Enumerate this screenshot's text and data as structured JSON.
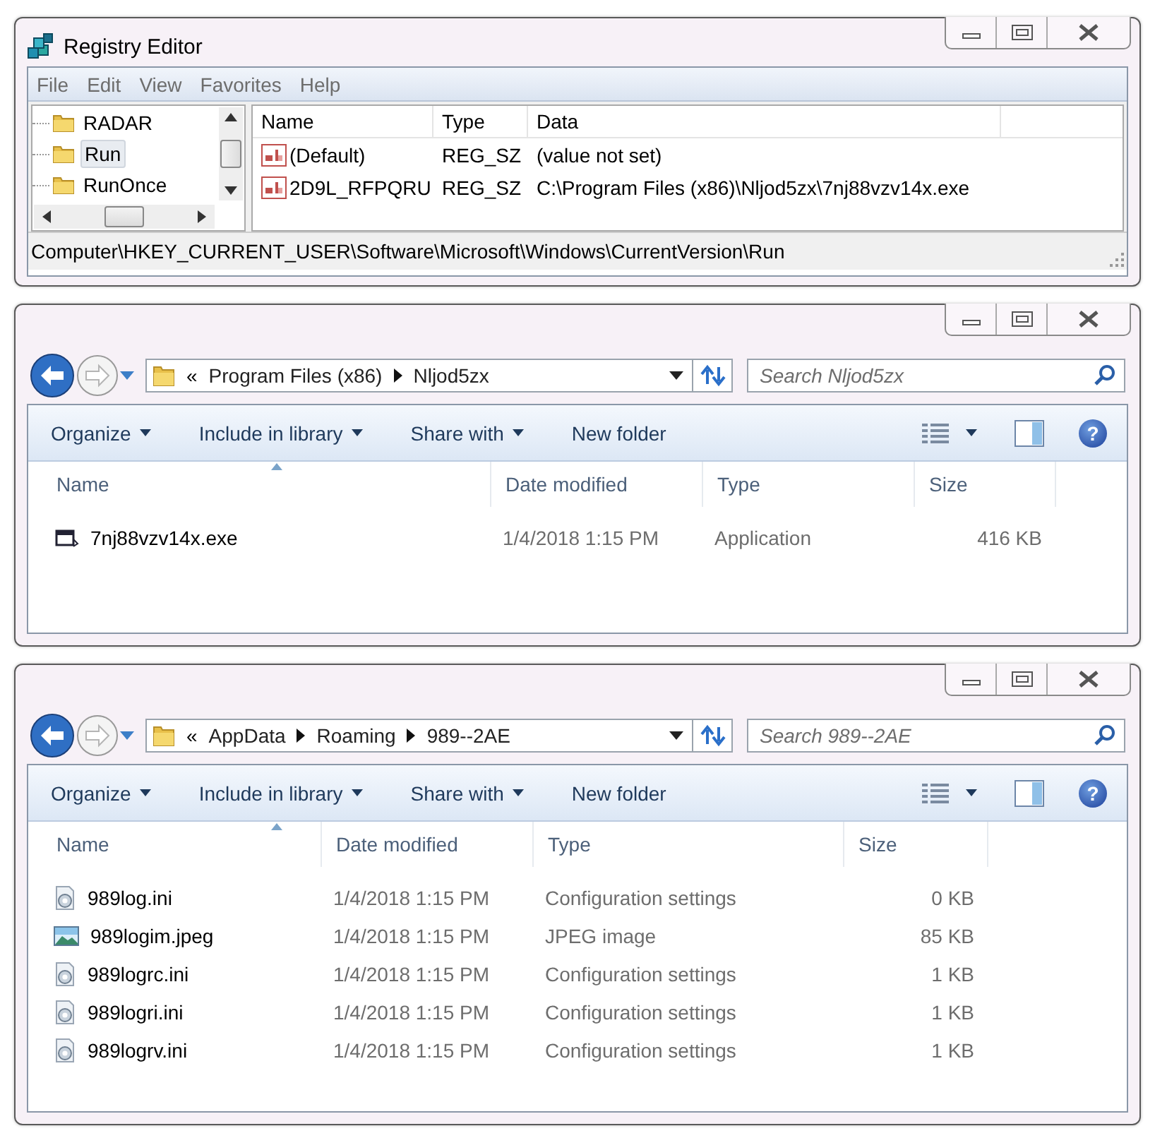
{
  "registry_editor": {
    "title": "Registry Editor",
    "menu": [
      "File",
      "Edit",
      "View",
      "Favorites",
      "Help"
    ],
    "tree": [
      {
        "label": "RADAR",
        "selected": false
      },
      {
        "label": "Run",
        "selected": true
      },
      {
        "label": "RunOnce",
        "selected": false
      }
    ],
    "columns": [
      "Name",
      "Type",
      "Data"
    ],
    "values": [
      {
        "name": "(Default)",
        "type": "REG_SZ",
        "data": "(value not set)"
      },
      {
        "name": "2D9L_RFPQRU",
        "type": "REG_SZ",
        "data": "C:\\Program Files (x86)\\Nljod5zx\\7nj88vzv14x.exe"
      }
    ],
    "status_bar": "Computer\\HKEY_CURRENT_USER\\Software\\Microsoft\\Windows\\CurrentVersion\\Run"
  },
  "explorers": [
    {
      "overflow": "«",
      "breadcrumb": [
        "Program Files (x86)",
        "Nljod5zx"
      ],
      "search": {
        "placeholder": "Search Nljod5zx"
      },
      "toolbar": [
        {
          "label": "Organize",
          "dropdown": true
        },
        {
          "label": "Include in library",
          "dropdown": true
        },
        {
          "label": "Share with",
          "dropdown": true
        },
        {
          "label": "New folder",
          "dropdown": false
        }
      ],
      "help": "?",
      "columns": [
        "Name",
        "Date modified",
        "Type",
        "Size"
      ],
      "files": [
        {
          "kind": "application",
          "name": "7nj88vzv14x.exe",
          "date": "1/4/2018 1:15 PM",
          "type": "Application",
          "size": "416 KB"
        }
      ]
    },
    {
      "overflow": "«",
      "breadcrumb": [
        "AppData",
        "Roaming",
        "989--2AE"
      ],
      "search": {
        "placeholder": "Search 989--2AE"
      },
      "toolbar": [
        {
          "label": "Organize",
          "dropdown": true
        },
        {
          "label": "Include in library",
          "dropdown": true
        },
        {
          "label": "Share with",
          "dropdown": true
        },
        {
          "label": "New folder",
          "dropdown": false
        }
      ],
      "help": "?",
      "columns": [
        "Name",
        "Date modified",
        "Type",
        "Size"
      ],
      "files": [
        {
          "kind": "settings",
          "name": "989log.ini",
          "date": "1/4/2018 1:15 PM",
          "type": "Configuration settings",
          "size": "0 KB"
        },
        {
          "kind": "image",
          "name": "989logim.jpeg",
          "date": "1/4/2018 1:15 PM",
          "type": "JPEG image",
          "size": "85 KB"
        },
        {
          "kind": "settings",
          "name": "989logrc.ini",
          "date": "1/4/2018 1:15 PM",
          "type": "Configuration settings",
          "size": "1 KB"
        },
        {
          "kind": "settings",
          "name": "989logri.ini",
          "date": "1/4/2018 1:15 PM",
          "type": "Configuration settings",
          "size": "1 KB"
        },
        {
          "kind": "settings",
          "name": "989logrv.ini",
          "date": "1/4/2018 1:15 PM",
          "type": "Configuration settings",
          "size": "1 KB"
        }
      ]
    }
  ]
}
